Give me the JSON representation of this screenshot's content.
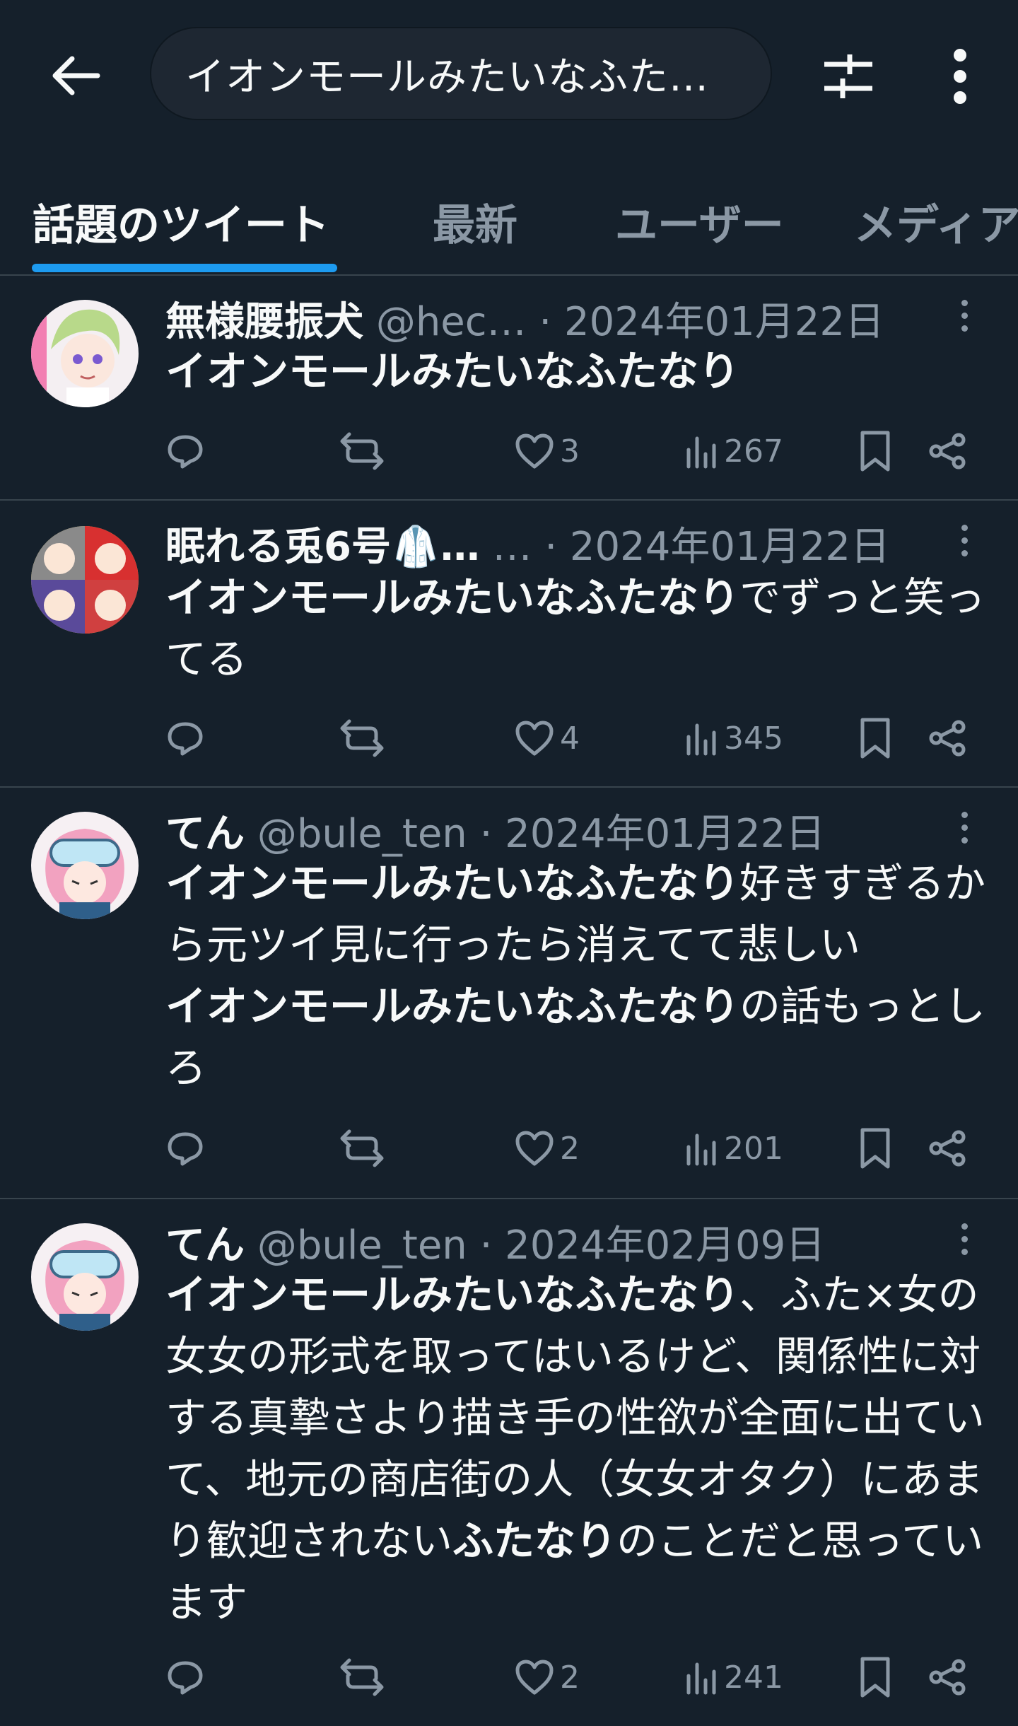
{
  "header": {
    "search_query": "イオンモールみたいなふた…"
  },
  "tabs": [
    {
      "label": "話題のツイート",
      "active": true
    },
    {
      "label": "最新",
      "active": false
    },
    {
      "label": "ユーザー",
      "active": false
    },
    {
      "label": "メディア",
      "active": false
    }
  ],
  "tweets": [
    {
      "display_name": "無様腰振犬",
      "meta": "@hec… · 2024年01月22日",
      "body": [
        {
          "bold": true,
          "text": "イオンモールみたいなふたなり"
        }
      ],
      "replies": "",
      "retweets": "",
      "likes": "3",
      "views": "267"
    },
    {
      "display_name": "眠れる兎6号🥼…",
      "meta": "… · 2024年01月22日",
      "body": [
        {
          "bold": true,
          "text": "イオンモールみたいなふたなり"
        },
        {
          "bold": false,
          "text": "でずっと笑ってる"
        }
      ],
      "replies": "",
      "retweets": "",
      "likes": "4",
      "views": "345"
    },
    {
      "display_name": "てん",
      "meta": "@bule_ten · 2024年01月22日",
      "body": [
        {
          "bold": true,
          "text": "イオンモールみたいなふたなり"
        },
        {
          "bold": false,
          "text": "好きすぎるから元ツイ見に行ったら消えてて悲しい"
        },
        {
          "bold": true,
          "text": "イオンモールみたいなふたなり"
        },
        {
          "bold": false,
          "text": "の話もっとしろ"
        }
      ],
      "replies": "",
      "retweets": "",
      "likes": "2",
      "views": "201"
    },
    {
      "display_name": "てん",
      "meta": "@bule_ten · 2024年02月09日",
      "body": [
        {
          "bold": true,
          "text": "イオンモールみたいなふたなり"
        },
        {
          "bold": false,
          "text": "、ふた×女の女女の形式を取ってはいるけど、関係性に対する真摯さより描き手の性欲が全面に出ていて、地元の商店街の人（女女オタク）にあまり歓迎されない"
        },
        {
          "bold": true,
          "text": "ふたなり"
        },
        {
          "bold": false,
          "text": "のことだと思っています"
        }
      ],
      "replies": "",
      "retweets": "",
      "likes": "2",
      "views": "241"
    }
  ],
  "colors": {
    "background": "#15202b",
    "accent": "#1d9bf0",
    "secondary_text": "#8b98a5",
    "divider": "#38444d"
  },
  "icons": [
    "back-arrow-icon",
    "filter-icon",
    "more-vertical-icon",
    "reply-icon",
    "retweet-icon",
    "like-icon",
    "views-icon",
    "bookmark-icon",
    "share-icon"
  ]
}
